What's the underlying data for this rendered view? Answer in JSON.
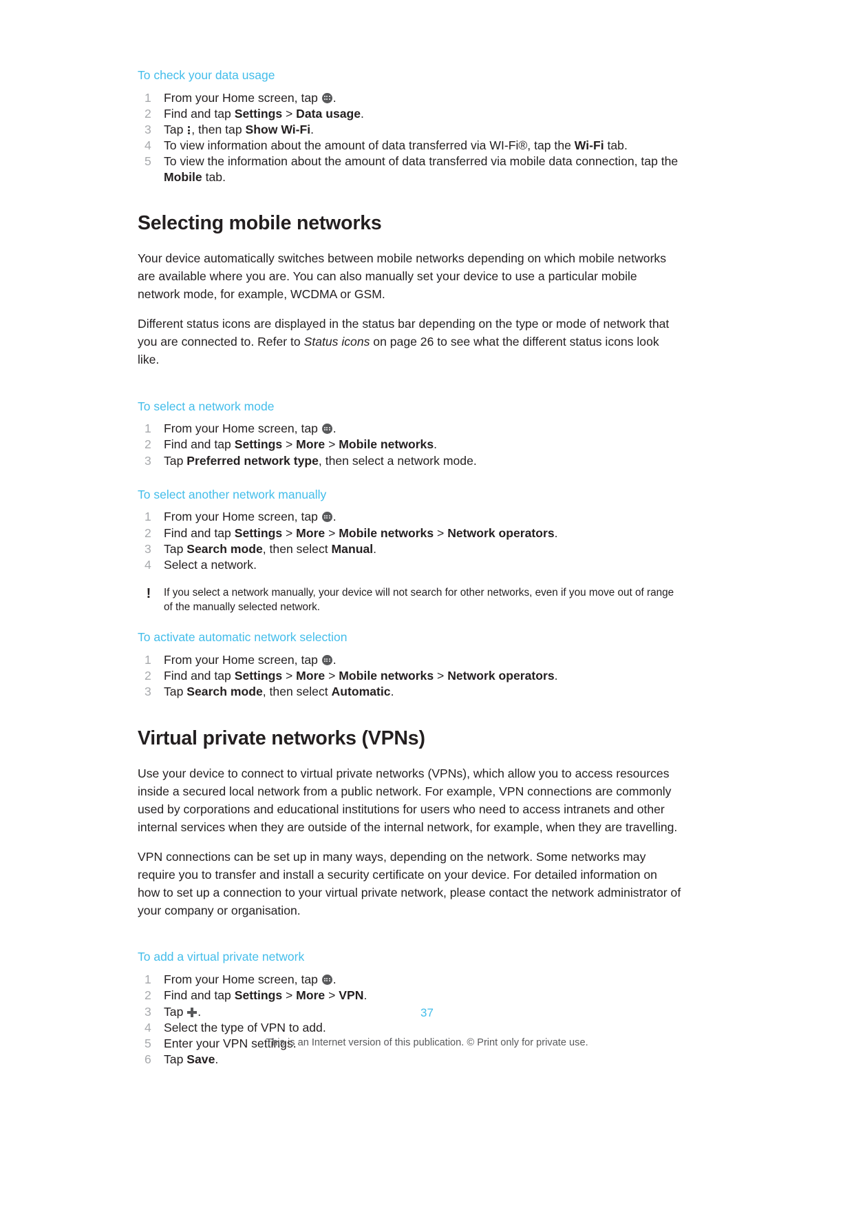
{
  "page": {
    "number": "37",
    "footer_note": "This is an Internet version of this publication. © Print only for private use."
  },
  "procedures": {
    "check_data_usage": {
      "title": "To check your data usage",
      "steps": [
        {
          "pre": "From your Home screen, tap ",
          "icon": "apps-icon",
          "post": "."
        },
        {
          "pre": "Find and tap ",
          "bold1": "Settings",
          "mid1": " > ",
          "bold2": "Data usage",
          "post": "."
        },
        {
          "pre": "Tap ",
          "icon": "overflow-menu-icon",
          "mid1": ", then tap ",
          "bold1": "Show Wi-Fi",
          "post": "."
        },
        {
          "pre": "To view information about the amount of data transferred via WI-Fi®, tap the ",
          "bold1": "Wi-Fi",
          "post": " tab."
        },
        {
          "pre": "To view the information about the amount of data transferred via mobile data connection, tap the ",
          "bold1": "Mobile",
          "post": " tab."
        }
      ]
    },
    "select_network_mode": {
      "title": "To select a network mode",
      "steps": [
        {
          "pre": "From your Home screen, tap ",
          "icon": "apps-icon",
          "post": "."
        },
        {
          "pre": "Find and tap ",
          "bold1": "Settings",
          "mid1": " > ",
          "bold2": "More",
          "mid2": " > ",
          "bold3": "Mobile networks",
          "post": "."
        },
        {
          "pre": "Tap ",
          "bold1": "Preferred network type",
          "post": ", then select a network mode."
        }
      ]
    },
    "select_network_manually": {
      "title": "To select another network manually",
      "steps": [
        {
          "pre": "From your Home screen, tap ",
          "icon": "apps-icon",
          "post": "."
        },
        {
          "pre": "Find and tap ",
          "bold1": "Settings",
          "mid1": " > ",
          "bold2": "More",
          "mid2": " > ",
          "bold3": "Mobile networks",
          "mid3": " > ",
          "bold4": "Network operators",
          "post": "."
        },
        {
          "pre": "Tap ",
          "bold1": "Search mode",
          "mid1": ", then select ",
          "bold2": "Manual",
          "post": "."
        },
        {
          "pre": "Select a network.",
          "post": ""
        }
      ],
      "note": "If you select a network manually, your device will not search for other networks, even if you move out of range of the manually selected network."
    },
    "activate_automatic_selection": {
      "title": "To activate automatic network selection",
      "steps": [
        {
          "pre": "From your Home screen, tap ",
          "icon": "apps-icon",
          "post": "."
        },
        {
          "pre": "Find and tap ",
          "bold1": "Settings",
          "mid1": " > ",
          "bold2": "More",
          "mid2": " > ",
          "bold3": "Mobile networks",
          "mid3": " > ",
          "bold4": "Network operators",
          "post": "."
        },
        {
          "pre": "Tap ",
          "bold1": "Search mode",
          "mid1": ", then select ",
          "bold2": "Automatic",
          "post": "."
        }
      ]
    },
    "add_vpn": {
      "title": "To add a virtual private network",
      "steps": [
        {
          "pre": "From your Home screen, tap ",
          "icon": "apps-icon",
          "post": "."
        },
        {
          "pre": "Find and tap ",
          "bold1": "Settings",
          "mid1": " > ",
          "bold2": "More",
          "mid2": " > ",
          "bold3": "VPN",
          "post": "."
        },
        {
          "pre": "Tap ",
          "icon": "plus-icon",
          "post": "."
        },
        {
          "pre": "Select the type of VPN to add.",
          "post": ""
        },
        {
          "pre": "Enter your VPN settings.",
          "post": ""
        },
        {
          "pre": "Tap ",
          "bold1": "Save",
          "post": "."
        }
      ]
    }
  },
  "sections": {
    "selecting_mobile_networks": {
      "heading": "Selecting mobile networks",
      "para1": "Your device automatically switches between mobile networks depending on which mobile networks are available where you are. You can also manually set your device to use a particular mobile network mode, for example, WCDMA or GSM.",
      "para2_part1": "Different status icons are displayed in the status bar depending on the type or mode of network that you are connected to. Refer to ",
      "para2_italic": "Status icons",
      "para2_part2": " on page 26 to see what the different status icons look like."
    },
    "virtual_private_networks": {
      "heading": "Virtual private networks (VPNs)",
      "para1": "Use your device to connect to virtual private networks (VPNs), which allow you to access resources inside a secured local network from a public network. For example, VPN connections are commonly used by corporations and educational institutions for users who need to access intranets and other internal services when they are outside of the internal network, for example, when they are travelling.",
      "para2": "VPN connections can be set up in many ways, depending on the network. Some networks may require you to transfer and install a security certificate on your device. For detailed information on how to set up a connection to your virtual private network, please contact the network administrator of your company or organisation."
    }
  },
  "colors": {
    "accent": "#43bdea",
    "text": "#231f20",
    "muted": "#a7a9ac"
  }
}
